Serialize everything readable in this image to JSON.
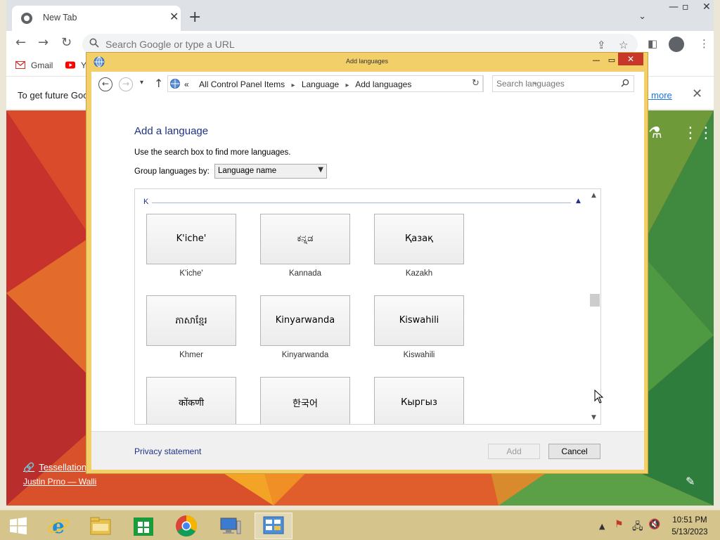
{
  "browser": {
    "tab_title": "New Tab",
    "omnibox_placeholder": "Search Google or type a URL",
    "bookmarks": [
      {
        "label": "Gmail"
      },
      {
        "label": "Y"
      }
    ],
    "infobar_text": "To get future Goo",
    "infobar_link": "rn more",
    "ntp": {
      "caption_title": "Tessellation",
      "caption_author": "Justin Prno — Walli"
    }
  },
  "dialog": {
    "title": "Add languages",
    "breadcrumb_prefix": "«",
    "breadcrumbs": [
      "All Control Panel Items",
      "Language",
      "Add languages"
    ],
    "search_placeholder": "Search languages",
    "heading": "Add a language",
    "instructions": "Use the search box to find more languages.",
    "group_label": "Group languages by:",
    "group_value": "Language name",
    "group_letter": "K",
    "languages": [
      {
        "native": "K'iche'",
        "name": "K'iche'"
      },
      {
        "native": "ಕನ್ನಡ",
        "name": "Kannada"
      },
      {
        "native": "Қазақ",
        "name": "Kazakh"
      },
      {
        "native": "ភាសាខ្មែរ",
        "name": "Khmer"
      },
      {
        "native": "Kinyarwanda",
        "name": "Kinyarwanda"
      },
      {
        "native": "Kiswahili",
        "name": "Kiswahili"
      },
      {
        "native": "कोंकणी",
        "name": ""
      },
      {
        "native": "한국어",
        "name": ""
      },
      {
        "native": "Кыргыз",
        "name": ""
      }
    ],
    "privacy_link": "Privacy statement",
    "add_button": "Add",
    "cancel_button": "Cancel"
  },
  "taskbar": {
    "time": "10:51 PM",
    "date": "5/13/2023"
  },
  "colors": {
    "dialog_frame": "#f3cf6a",
    "link_blue": "#1e3287",
    "chrome_link": "#1a73e8"
  }
}
